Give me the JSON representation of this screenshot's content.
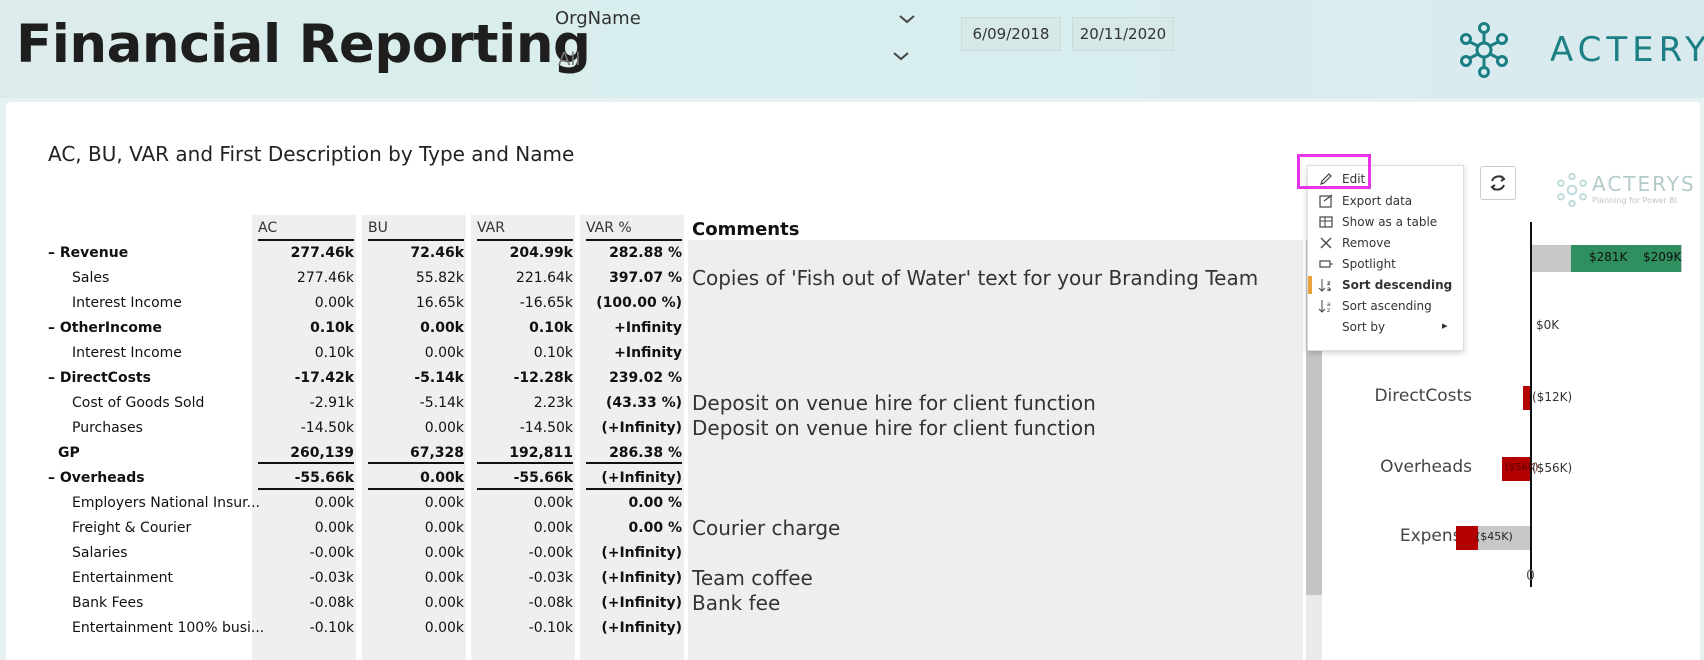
{
  "header": {
    "title": "Financial Reporting",
    "org_label": "OrgName",
    "org_value": "All",
    "date_start": "6/09/2018",
    "date_end": "20/11/2020",
    "logo_text": "ACTERYS"
  },
  "visual": {
    "title": "AC, BU, VAR and First Description by Type and Name",
    "columns": [
      "AC",
      "BU",
      "VAR",
      "VAR %"
    ],
    "comments_header": "Comments",
    "rows": [
      {
        "label": "– Revenue",
        "ac": "277.46k",
        "bu": "72.46k",
        "var": "204.99k",
        "varp": "282.88 %",
        "bold": true,
        "comment": ""
      },
      {
        "label": "Sales",
        "ac": "277.46k",
        "bu": "55.82k",
        "var": "221.64k",
        "varp": "397.07 %",
        "bold": false,
        "comment": "Copies of 'Fish out of Water' text for your Branding Team"
      },
      {
        "label": "Interest Income",
        "ac": "0.00k",
        "bu": "16.65k",
        "var": "-16.65k",
        "varp": "(100.00 %)",
        "bold": false,
        "comment": ""
      },
      {
        "label": "– OtherIncome",
        "ac": "0.10k",
        "bu": "0.00k",
        "var": "0.10k",
        "varp": "+Infinity",
        "bold": true,
        "comment": ""
      },
      {
        "label": "Interest Income",
        "ac": "0.10k",
        "bu": "0.00k",
        "var": "0.10k",
        "varp": "+Infinity",
        "bold": false,
        "comment": ""
      },
      {
        "label": "– DirectCosts",
        "ac": "-17.42k",
        "bu": "-5.14k",
        "var": "-12.28k",
        "varp": "239.02 %",
        "bold": true,
        "comment": ""
      },
      {
        "label": "Cost of Goods Sold",
        "ac": "-2.91k",
        "bu": "-5.14k",
        "var": "2.23k",
        "varp": "(43.33 %)",
        "bold": false,
        "comment": "Deposit on venue hire for client function"
      },
      {
        "label": "Purchases",
        "ac": "-14.50k",
        "bu": "0.00k",
        "var": "-14.50k",
        "varp": "(+Infinity)",
        "bold": false,
        "comment": "Deposit on venue hire for client function"
      },
      {
        "label": "GP",
        "ac": "260,139",
        "bu": "67,328",
        "var": "192,811",
        "varp": "286.38 %",
        "bold": true,
        "comment": ""
      },
      {
        "label": "– Overheads",
        "ac": "-55.66k",
        "bu": "0.00k",
        "var": "-55.66k",
        "varp": "(+Infinity)",
        "bold": true,
        "comment": ""
      },
      {
        "label": "Employers National Insur...",
        "ac": "0.00k",
        "bu": "0.00k",
        "var": "0.00k",
        "varp": "0.00 %",
        "bold": false,
        "comment": ""
      },
      {
        "label": "Freight & Courier",
        "ac": "0.00k",
        "bu": "0.00k",
        "var": "0.00k",
        "varp": "0.00 %",
        "bold": false,
        "comment": "Courier charge"
      },
      {
        "label": "Salaries",
        "ac": "-0.00k",
        "bu": "0.00k",
        "var": "-0.00k",
        "varp": "(+Infinity)",
        "bold": false,
        "comment": ""
      },
      {
        "label": "Entertainment",
        "ac": "-0.03k",
        "bu": "0.00k",
        "var": "-0.03k",
        "varp": "(+Infinity)",
        "bold": false,
        "comment": "Team coffee"
      },
      {
        "label": "Bank Fees",
        "ac": "-0.08k",
        "bu": "0.00k",
        "var": "-0.08k",
        "varp": "(+Infinity)",
        "bold": false,
        "comment": "Bank fee"
      },
      {
        "label": "Entertainment 100% busi...",
        "ac": "-0.10k",
        "bu": "0.00k",
        "var": "-0.10k",
        "varp": "(+Infinity)",
        "bold": false,
        "comment": ""
      }
    ]
  },
  "chart": {
    "categories": [
      "DirectCosts",
      "Overheads",
      "Expense"
    ],
    "revenue_labels": [
      "$281K",
      "$209K"
    ],
    "other_label": "$0K",
    "directcosts_label": "($12K)",
    "overheads_label": "($56K)",
    "overheads_inner": "($56K)",
    "expense_label": "($45K)",
    "expense_inner": "($45K)",
    "axis_zero": "0",
    "logo_text": "ACTERYS",
    "logo_sub": "Planning for Power BI",
    "colors": {
      "green": "#2f8f5e",
      "red": "#b30000",
      "grey": "#c8c8c8"
    }
  },
  "context_menu": {
    "items": [
      {
        "label": "Edit",
        "icon": "pencil-icon"
      },
      {
        "label": "Export data",
        "icon": "export-icon"
      },
      {
        "label": "Show as a table",
        "icon": "table-icon"
      },
      {
        "label": "Remove",
        "icon": "close-icon"
      },
      {
        "label": "Spotlight",
        "icon": "spotlight-icon"
      },
      {
        "label": "Sort descending",
        "icon": "sort-descending-icon"
      },
      {
        "label": "Sort ascending",
        "icon": "sort-ascending-icon"
      },
      {
        "label": "Sort by",
        "icon": ""
      }
    ],
    "sort_by_arrow": "▸"
  }
}
